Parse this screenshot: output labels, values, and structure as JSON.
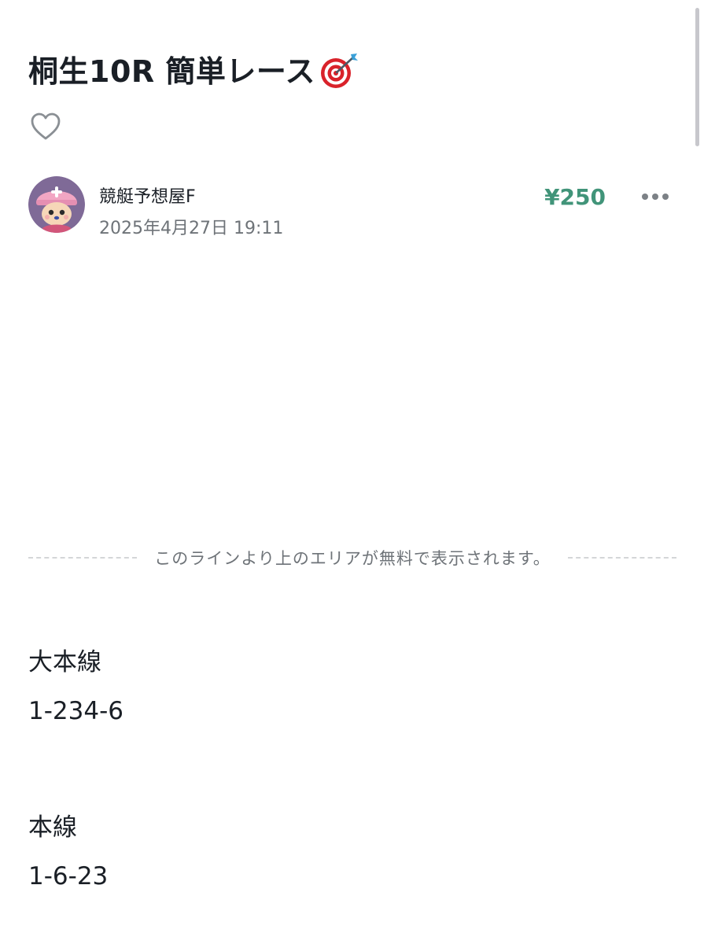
{
  "article": {
    "title": "桐生10R 簡単レース",
    "title_emoji_icon": "direct-hit-target-icon",
    "like_icon": "heart-outline-icon"
  },
  "author": {
    "name": "競艇予想屋F",
    "date": "2025年4月27日 19:11",
    "avatar_icon": "character-avatar-icon"
  },
  "price": "¥250",
  "menu_icon": "more-horizontal-icon",
  "paywall": {
    "notice": "このラインより上のエリアが無料で表示されます。"
  },
  "content": {
    "lines": [
      "大本線",
      "1-234-6",
      "本線",
      "1-6-23"
    ]
  },
  "colors": {
    "price_green": "#419479",
    "text_dark": "#1a1f26",
    "text_gray": "#6e7378",
    "divider": "#d4d6d8"
  }
}
